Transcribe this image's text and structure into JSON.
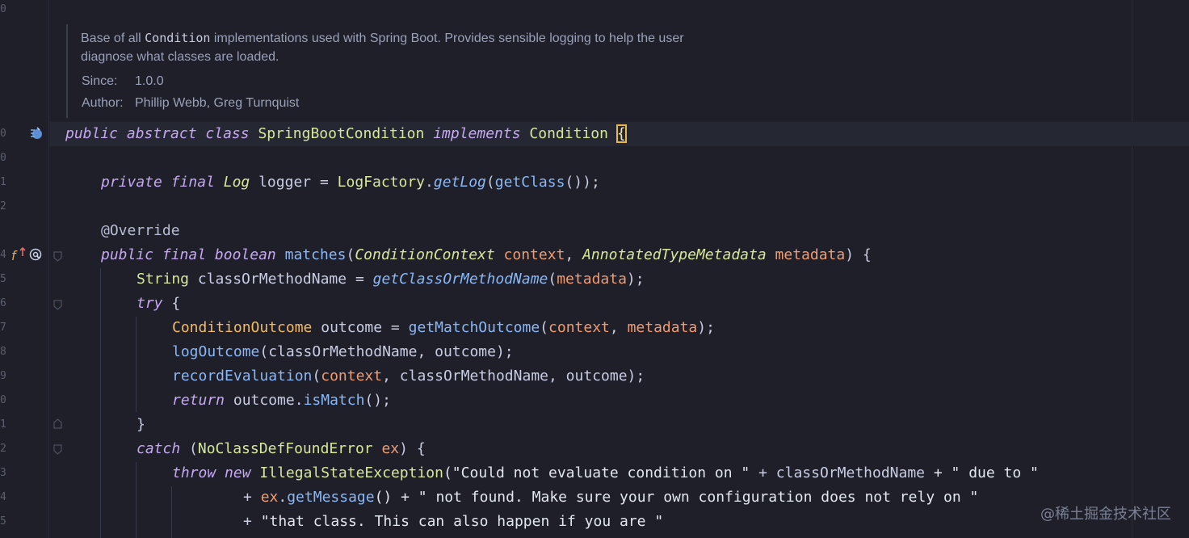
{
  "doc": {
    "line1_a": "Base of all ",
    "line1_code": "Condition",
    "line1_b": " implementations used with Spring Boot. Provides sensible logging to help the user",
    "line2": "diagnose what classes are loaded.",
    "since_label": "Since:",
    "since_value": "1.0.0",
    "author_label": "Author:",
    "author_value": "Phillip Webb, Greg Turnquist"
  },
  "line_numbers": [
    "0",
    "",
    "",
    "0",
    "1",
    "2",
    "",
    "4",
    "5",
    "6",
    "7",
    "8",
    "9",
    "0",
    "1",
    "2",
    "3",
    "4",
    "5"
  ],
  "code": {
    "l1_kw1": "public",
    "l1_kw2": "abstract",
    "l1_kw3": "class",
    "l1_name": "SpringBootCondition",
    "l1_kw4": "implements",
    "l1_iface": "Condition",
    "l1_brace": "{",
    "l2_kw1": "private",
    "l2_kw2": "final",
    "l2_type": "Log",
    "l2_var": "logger",
    "l2_eq": " = ",
    "l2_cls": "LogFactory",
    "l2_dot": ".",
    "l2_m": "getLog",
    "l2_p1": "(",
    "l2_m2": "getClass",
    "l2_end": "());",
    "l3_ann": "@Override",
    "l4_kw1": "public",
    "l4_kw2": "final",
    "l4_kw3": "boolean",
    "l4_m": "matches",
    "l4_p1": "(",
    "l4_t1": "ConditionContext",
    "l4_a1": "context",
    "l4_c": ", ",
    "l4_t2": "AnnotatedTypeMetadata",
    "l4_a2": "metadata",
    "l4_end": ") {",
    "l5_type": "String",
    "l5_var": "classOrMethodName",
    "l5_eq": " = ",
    "l5_m": "getClassOrMethodName",
    "l5_p1": "(",
    "l5_a": "metadata",
    "l5_end": ");",
    "l6_kw": "try",
    "l6_end": " {",
    "l7_type": "ConditionOutcome",
    "l7_var": "outcome",
    "l7_eq": " = ",
    "l7_m": "getMatchOutcome",
    "l7_p1": "(",
    "l7_a1": "context",
    "l7_c": ", ",
    "l7_a2": "metadata",
    "l7_end": ");",
    "l8_m": "logOutcome",
    "l8_rest": "(classOrMethodName, outcome);",
    "l9_m": "recordEvaluation",
    "l9_p1": "(",
    "l9_a1": "context",
    "l9_rest": ", classOrMethodName, outcome);",
    "l10_kw": "return",
    "l10_var": "outcome",
    "l10_dot": ".",
    "l10_m": "isMatch",
    "l10_end": "();",
    "l11_brace": "}",
    "l12_kw": "catch",
    "l12_p1": " (",
    "l12_type": "NoClassDefFoundError",
    "l12_var": "ex",
    "l12_end": ") {",
    "l13_kw1": "throw",
    "l13_kw2": "new",
    "l13_cls": "IllegalStateException",
    "l13_s1": "(\"Could not evaluate condition on \"",
    "l13_plus": " + ",
    "l13_v": "classOrMethodName",
    "l13_s2": " + \" due to \"",
    "l14_plus": "+ ",
    "l14_ex": "ex",
    "l14_dot": ".",
    "l14_m": "getMessage",
    "l14_rest": "() + \" not found. Make sure your own configuration does not rely on \"",
    "l15_plus": "+ ",
    "l15_s": "\"that class. This can also happen if you are \""
  },
  "icons": {
    "bean": "spring-bean-icon",
    "override": "override-method-icon",
    "at": "annotation-at-icon"
  },
  "watermark": "@稀土掘金技术社区",
  "colors": {
    "background": "#1e1f29",
    "keyword": "#c6a8f2",
    "type": "#d6e79c",
    "method": "#8ab7f5",
    "param": "#ee9c74",
    "caret": "#e8b84a"
  }
}
